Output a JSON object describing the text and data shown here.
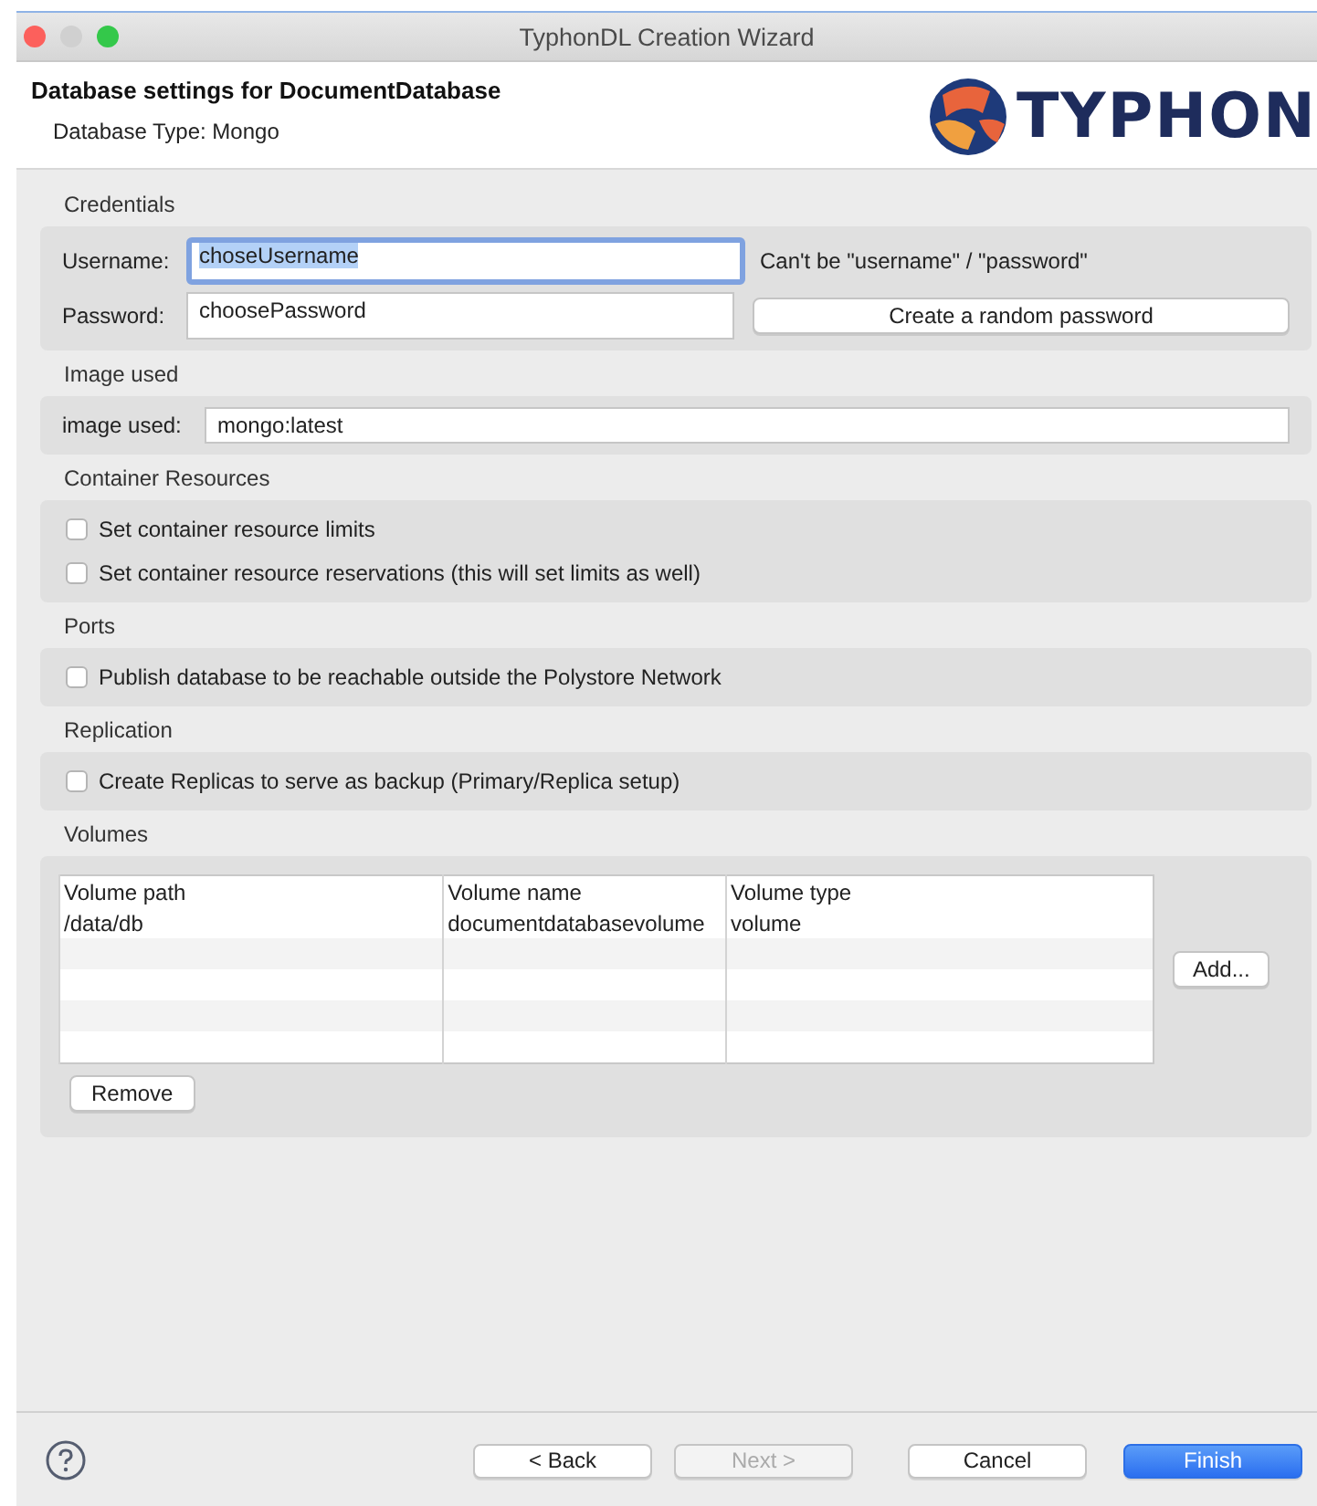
{
  "window": {
    "title": "TyphonDL Creation Wizard"
  },
  "header": {
    "title": "Database settings for DocumentDatabase",
    "subtitle": "Database Type: Mongo",
    "logo_text": "TYPHON"
  },
  "credentials": {
    "title": "Credentials",
    "username": {
      "label": "Username:",
      "value": "choseUsername",
      "focused": true,
      "hint": "Can't be \"username\" / \"password\""
    },
    "password": {
      "label": "Password:",
      "value": "choosePassword",
      "focused": false,
      "button": "Create a random password"
    }
  },
  "image": {
    "title": "Image used",
    "label": "image used:",
    "value": "mongo:latest"
  },
  "container_resources": {
    "title": "Container Resources",
    "options": [
      {
        "label": "Set container resource limits",
        "checked": false
      },
      {
        "label": "Set container resource reservations (this will set limits as well)",
        "checked": false
      }
    ]
  },
  "ports": {
    "title": "Ports",
    "options": [
      {
        "label": "Publish database to be reachable outside the Polystore Network",
        "checked": false
      }
    ]
  },
  "replication": {
    "title": "Replication",
    "options": [
      {
        "label": "Create Replicas to serve as backup (Primary/Replica setup)",
        "checked": false
      }
    ]
  },
  "volumes": {
    "title": "Volumes",
    "columns": [
      "Volume path",
      "Volume name",
      "Volume type"
    ],
    "rows": [
      [
        "/data/db",
        "documentdatabasevolume",
        "volume"
      ]
    ],
    "add_button": "Add...",
    "remove_button": "Remove"
  },
  "footer": {
    "buttons": [
      {
        "label": "< Back",
        "kind": "normal",
        "disabled": false
      },
      {
        "label": "Next >",
        "kind": "normal",
        "disabled": true
      },
      {
        "label": "Cancel",
        "kind": "normal",
        "disabled": false
      },
      {
        "label": "Finish",
        "kind": "primary",
        "disabled": false
      }
    ]
  }
}
